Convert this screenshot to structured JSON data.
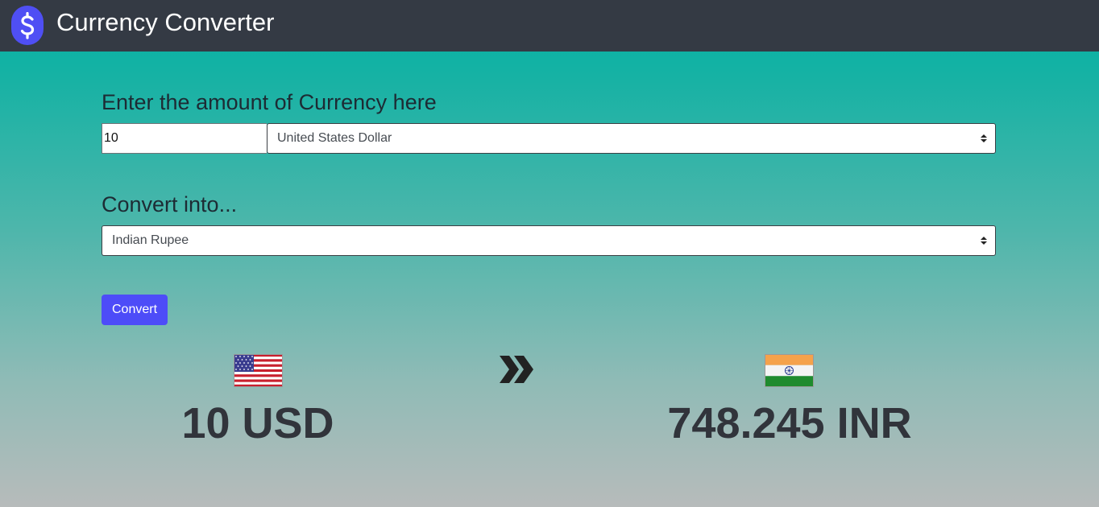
{
  "navbar": {
    "title": "Currency Converter",
    "logo_icon": "dollar-icon",
    "logo_color": "#4f4ff4",
    "background": "#343a44"
  },
  "form": {
    "amount_label": "Enter the amount of Currency here",
    "amount_value": "10",
    "from_currency": "United States Dollar",
    "convert_label": "Convert into...",
    "to_currency": "Indian Rupee",
    "convert_button": "Convert",
    "button_color": "#4d4cf8"
  },
  "result": {
    "from_flag": "us-flag-icon",
    "from_text": "10 USD",
    "arrow_icon": "double-chevron-right-icon",
    "to_flag": "india-flag-icon",
    "to_text": "748.245 INR"
  }
}
